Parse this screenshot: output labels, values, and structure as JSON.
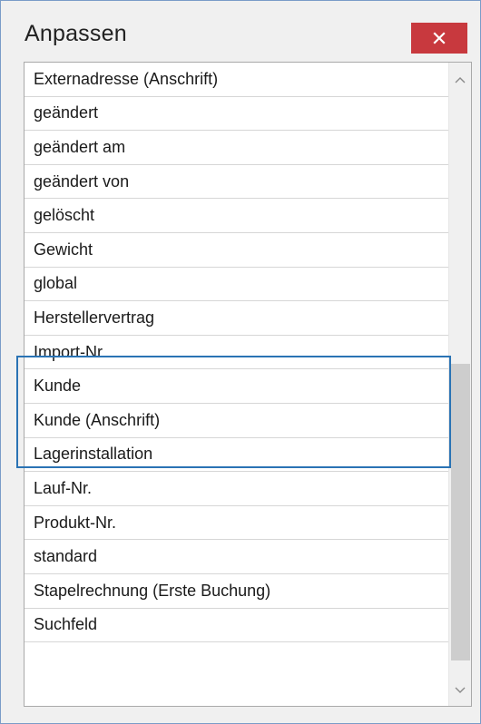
{
  "dialog": {
    "title": "Anpassen",
    "close_icon": "close-x-icon"
  },
  "list": {
    "items": [
      "Externadresse (Anschrift)",
      "geändert",
      "geändert am",
      "geändert von",
      "gelöscht",
      "Gewicht",
      "global",
      "Herstellervertrag",
      "Import-Nr.",
      "Kunde",
      "Kunde (Anschrift)",
      "Lagerinstallation",
      "Lauf-Nr.",
      "Produkt-Nr.",
      "standard",
      "Stapelrechnung (Erste Buchung)",
      "Suchfeld",
      ""
    ],
    "highlighted_items": [
      "Kunde",
      "Kunde (Anschrift)"
    ],
    "scrollbar": {
      "up_icon": "chevron-up-icon",
      "down_icon": "chevron-down-icon",
      "thumb_start_fraction": 0.468,
      "thumb_size_fraction": 0.462
    }
  },
  "colors": {
    "close_button": "#c8393e",
    "highlight_frame": "#2a73b4",
    "window_border": "#7a9cc8"
  }
}
